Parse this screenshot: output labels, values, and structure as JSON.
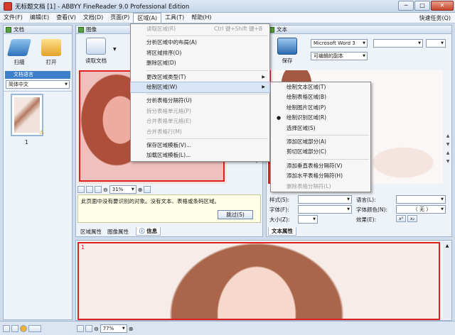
{
  "window": {
    "title": "无标题文档 [1] - ABBYY FineReader 9.0 Professional Edition",
    "min": "─",
    "max": "□",
    "close": "✕"
  },
  "menubar": {
    "items": [
      "文件(F)",
      "编辑(E)",
      "查看(V)",
      "文档(D)",
      "页面(P)",
      "区域(A)",
      "工具(T)",
      "帮助(H)"
    ],
    "tasks": "快速任务(Q)"
  },
  "doc_panel": {
    "header": "文档",
    "scan_label": "扫描",
    "open_label": "打开",
    "lang_header": "文档语言",
    "lang_value": "简体中文",
    "page_number": "1"
  },
  "image_panel": {
    "header": "图像",
    "read_label": "读取文档",
    "zoom": "31%",
    "info_text": "此页面中没有要识别的对象。没有文本、表格或条码区域。",
    "skip_button": "跳过(S)",
    "tabs": [
      "区域属性",
      "图像属性",
      "信息"
    ]
  },
  "text_panel": {
    "header": "文本",
    "save_label": "保存",
    "font_select": "Microsoft Word 3",
    "format_select": "可编辑的副本",
    "props": {
      "style_label": "样式(S):",
      "font_label": "字体(F):",
      "size_label": "大小(Z):",
      "lang_label": "语言(L):",
      "color_label": "字体颜色(N):",
      "color_value": "〈 无 〉",
      "effect_label": "效果(E):",
      "effect_values": [
        "x²",
        "x₂"
      ]
    },
    "tab": "文本属性"
  },
  "zoom_panel": {
    "zoom": "77%",
    "page_marker": "1"
  },
  "area_menu": {
    "items": [
      {
        "label": "读取区域(R)",
        "shortcut": "Ctrl 键+Shift 键+B",
        "disabled": true
      },
      {
        "sep": true
      },
      {
        "label": "分析区域中的布局(A)"
      },
      {
        "label": "将区域排序(O)"
      },
      {
        "label": "删除区域(D)"
      },
      {
        "sep": true
      },
      {
        "label": "更改区域类型(T)",
        "submenu": true
      },
      {
        "label": "绘制区域(W)",
        "submenu": true,
        "highlight": true
      },
      {
        "sep": true
      },
      {
        "label": "分析表格分隔符(U)"
      },
      {
        "label": "拆分表格单元格(P)",
        "disabled": true
      },
      {
        "label": "合并表格单元格(E)",
        "disabled": true
      },
      {
        "label": "合并表格行(M)",
        "disabled": true
      },
      {
        "sep": true
      },
      {
        "label": "保存区域模板(V)..."
      },
      {
        "label": "加载区域模板(L)..."
      }
    ]
  },
  "draw_submenu": {
    "items": [
      {
        "label": "绘制文本区域(T)"
      },
      {
        "label": "绘制表格区域(B)"
      },
      {
        "label": "绘制图片区域(P)"
      },
      {
        "label": "绘制识别区域(R)",
        "checked": true
      },
      {
        "label": "选择区域(S)"
      },
      {
        "sep": true
      },
      {
        "label": "添加区域部分(A)"
      },
      {
        "label": "剪切区域部分(C)"
      },
      {
        "sep": true
      },
      {
        "label": "添加垂直表格分隔符(V)"
      },
      {
        "label": "添加水平表格分隔符(H)"
      },
      {
        "label": "删除表格分隔符(L)",
        "disabled": true
      }
    ]
  },
  "colors": {
    "accent": "#3a6fb6",
    "selection_red": "#e02020",
    "menu_highlight": "#d8e5f6"
  }
}
